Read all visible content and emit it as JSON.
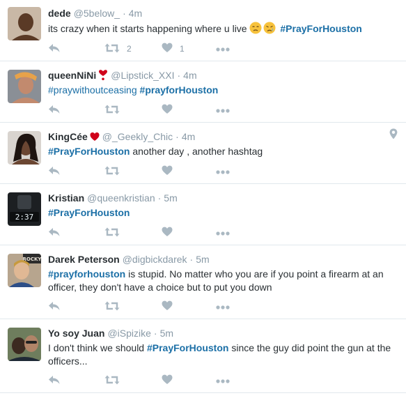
{
  "tweets": [
    {
      "name": "dede",
      "handle": "@5below_",
      "time": "4m",
      "segments": [
        {
          "text": "its crazy when it starts happening where u live ",
          "hashtag": false
        },
        {
          "emoji": "face-sad"
        },
        {
          "emoji": "face-cry"
        },
        {
          "text": " ",
          "hashtag": false
        },
        {
          "text": "#PrayForHouston",
          "hashtag": true
        }
      ],
      "retweets": "2",
      "likes": "1"
    },
    {
      "name": "queenNiNi",
      "name_emoji": "heart-exclamation",
      "handle": "@Lipstick_XXI",
      "time": "4m",
      "segments": [
        {
          "text": "#praywithoutceasing",
          "hashtag": true,
          "plain": true
        },
        {
          "text": " ",
          "hashtag": false
        },
        {
          "text": "#prayforHouston",
          "hashtag": true
        }
      ],
      "retweets": "",
      "likes": ""
    },
    {
      "name": "KingCée",
      "name_emoji": "heart",
      "handle": "@_Geekly_Chic",
      "time": "4m",
      "geo": "location-pin-icon",
      "segments": [
        {
          "text": "#PrayForHouston",
          "hashtag": true
        },
        {
          "text": " another day , another hashtag",
          "hashtag": false
        }
      ],
      "retweets": "",
      "likes": ""
    },
    {
      "name": "Kristian",
      "handle": "@queenkristian",
      "time": "5m",
      "avatar_text": "2:37",
      "segments": [
        {
          "text": "#PrayForHouston",
          "hashtag": true
        }
      ],
      "retweets": "",
      "likes": ""
    },
    {
      "name": "Darek Peterson",
      "handle": "@digbickdarek",
      "time": "5m",
      "avatar_text": "ROCKY",
      "segments": [
        {
          "text": "#prayforhouston",
          "hashtag": true
        },
        {
          "text": " is stupid. No matter who you are if you point a firearm at an officer, they don't have a choice but to put you down",
          "hashtag": false
        }
      ],
      "retweets": "",
      "likes": ""
    },
    {
      "name": "Yo soy Juan",
      "handle": "@iSpizike",
      "time": "5m",
      "segments": [
        {
          "text": "I don't think we should ",
          "hashtag": false
        },
        {
          "text": "#PrayForHouston",
          "hashtag": true
        },
        {
          "text": " since the guy did point the gun at the officers...",
          "hashtag": false
        }
      ],
      "retweets": "",
      "likes": ""
    }
  ],
  "separator": "·",
  "icons": {
    "reply": "reply-icon",
    "retweet": "retweet-icon",
    "like": "heart-icon",
    "more": "more-icon"
  },
  "colors": {
    "hashtag": "#1b6fa6",
    "meta": "#8899a6",
    "action": "#aab8c2",
    "heart": "#d0021b",
    "border": "#e1e8ed"
  }
}
